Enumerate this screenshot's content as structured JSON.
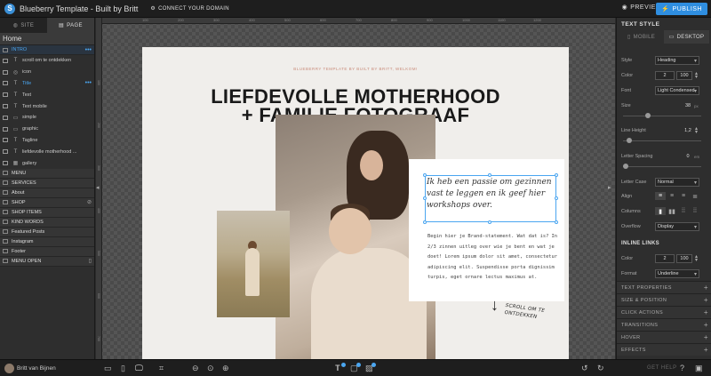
{
  "app": {
    "title": "Blueberry Template - Built by Britt",
    "connect_label": "CONNECT YOUR DOMAIN",
    "preview_label": "PREVIEW",
    "publish_label": "PUBLISH"
  },
  "left_panel": {
    "tabs": [
      {
        "label": "SITE"
      },
      {
        "label": "PAGE"
      }
    ],
    "home_label": "Home",
    "intro_section": "INTRO",
    "elements": [
      {
        "type": "text",
        "icon": "T",
        "label": "scroll om te ontdekken"
      },
      {
        "type": "icon",
        "icon": "◎",
        "label": "icon"
      },
      {
        "type": "text",
        "icon": "T",
        "label": "Title"
      },
      {
        "type": "text",
        "icon": "T",
        "label": "Text"
      },
      {
        "type": "text",
        "icon": "T",
        "label": "Text mobile"
      },
      {
        "type": "shape",
        "icon": "▭",
        "label": "simple"
      },
      {
        "type": "shape",
        "icon": "▭",
        "label": "graphic"
      },
      {
        "type": "text",
        "icon": "T",
        "label": "Tagline"
      },
      {
        "type": "text",
        "icon": "T",
        "label": "liefdevolle motherhood ..."
      },
      {
        "type": "gallery",
        "icon": "▦",
        "label": "gallery"
      }
    ],
    "sections": [
      {
        "label": "MENU",
        "device": ""
      },
      {
        "label": "SERVICES",
        "device": ""
      },
      {
        "label": "About",
        "device": ""
      },
      {
        "label": "SHOP",
        "device": "hidden-icon"
      },
      {
        "label": "SHOP ITEMS",
        "device": ""
      },
      {
        "label": "KIND WORDS",
        "device": ""
      },
      {
        "label": "Featured Posts",
        "device": ""
      },
      {
        "label": "Instagram",
        "device": ""
      },
      {
        "label": "Footer",
        "device": ""
      },
      {
        "label": "MENU OPEN",
        "device": "mobile-icon"
      }
    ]
  },
  "ruler": {
    "ticks": [
      "100",
      "200",
      "300",
      "400",
      "500",
      "600",
      "700",
      "800",
      "900",
      "1000",
      "1100",
      "1200"
    ],
    "vticks": [
      "100",
      "200",
      "300",
      "400",
      "500",
      "600",
      "700"
    ]
  },
  "page": {
    "brand_line": "BLUEBERRY TEMPLATE BY BUILT BY BRITT, WELKOM!",
    "headline_1": "LIEFDEVOLLE MOTHERHOOD",
    "headline_2": "+ FAMILIE FOTOGRAAF",
    "quote": "Ik heb een passie om gezinnen vast te leggen en ik geef hier workshops over.",
    "body": "Begin hier je Brand-statement. Wat dat is? In 2/3 zinnen uitleg over wie je bent en wat je doet! Lorem ipsum dolor sit amet, consectetur adipiscing elit. Suspendisse porta dignissim turpis, eget ornare lectus maximus at.",
    "scroll_note_1": "SCROLL OM TE",
    "scroll_note_2": "ONTDEKKEN"
  },
  "right_panel": {
    "title": "TEXT STYLE",
    "device_tabs": [
      {
        "label": "MOBILE"
      },
      {
        "label": "DESKTOP"
      }
    ],
    "style_label": "Style",
    "style_value": "Heading",
    "color_label": "Color",
    "color_value": "2",
    "color_opacity": "100",
    "font_label": "Font",
    "font_value": "Light Condensed",
    "size_label": "Size",
    "size_value": "38",
    "size_unit": "px",
    "size_level": 0.3,
    "line_height_label": "Line Height",
    "line_height_value": "1,2",
    "line_height_level": 0.05,
    "letter_spacing_label": "Letter Spacing",
    "letter_spacing_value": "0",
    "letter_spacing_unit": "em",
    "letter_spacing_level": 0.0,
    "letter_case_label": "Letter Case",
    "letter_case_value": "Normal",
    "align_label": "Align",
    "columns_label": "Columns",
    "overflow_label": "Overflow",
    "overflow_value": "Display",
    "inline_links_title": "INLINE LINKS",
    "link_color_label": "Color",
    "link_color_value": "2",
    "link_color_opacity": "100",
    "format_label": "Format",
    "format_value": "Underline",
    "accordions": [
      {
        "label": "TEXT PROPERTIES"
      },
      {
        "label": "SIZE & POSITION"
      },
      {
        "label": "CLICK ACTIONS"
      },
      {
        "label": "TRANSITIONS"
      },
      {
        "label": "HOVER"
      },
      {
        "label": "EFFECTS"
      }
    ]
  },
  "bottom_bar": {
    "username": "Britt van Bijnen",
    "get_help": "GET HELP"
  },
  "colors": {
    "accent": "#2f8ee0",
    "selection": "#4ba6f0",
    "brand_pink": "#c98b7a"
  }
}
